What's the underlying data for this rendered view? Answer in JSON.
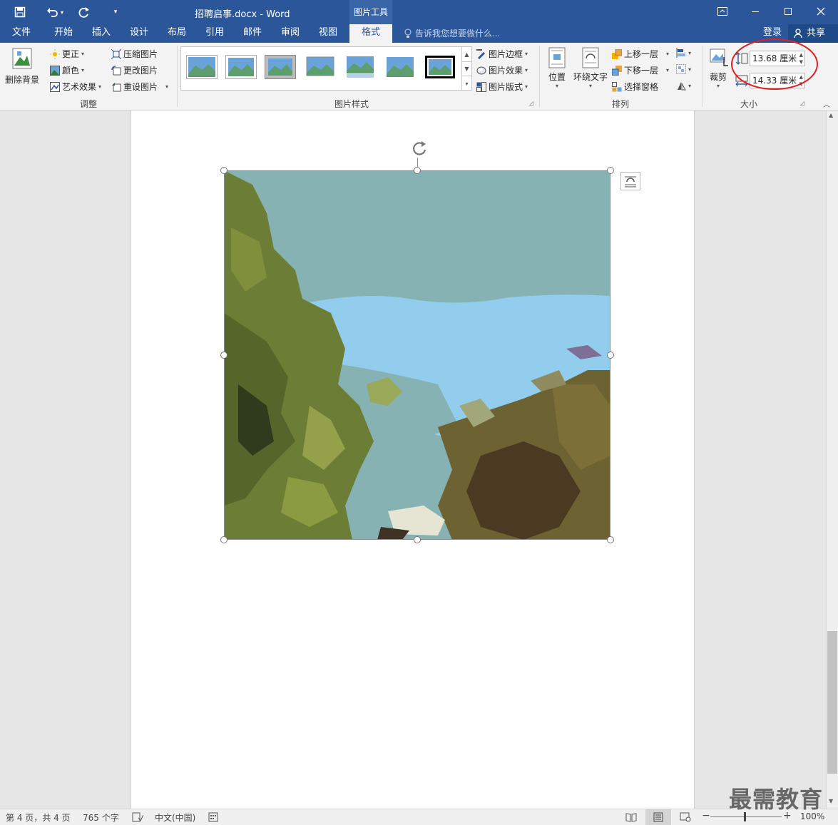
{
  "titlebar": {
    "document_title": "招聘启事.docx - Word",
    "contextual_tools": "图片工具",
    "icons": [
      "save-icon",
      "undo-icon",
      "redo-icon",
      "customize-icon",
      "ribbon-display-icon",
      "minimize-icon",
      "maximize-icon",
      "close-icon"
    ]
  },
  "tabs": {
    "items": [
      "文件",
      "开始",
      "插入",
      "设计",
      "布局",
      "引用",
      "邮件",
      "审阅",
      "视图",
      "格式"
    ],
    "active": "格式",
    "tell_me": "告诉我您想要做什么...",
    "sign_in": "登录",
    "share": "共享"
  },
  "ribbon": {
    "adjust": {
      "label": "调整",
      "remove_background": "删除背景",
      "corrections": "更正",
      "color": "颜色",
      "artistic_effects": "艺术效果",
      "compress": "压缩图片",
      "change_picture": "更改图片",
      "reset_picture": "重设图片"
    },
    "picture_styles": {
      "label": "图片样式",
      "border": "图片边框",
      "effects": "图片效果",
      "layout": "图片版式",
      "style_count": 7
    },
    "arrange": {
      "label": "排列",
      "position": "位置",
      "wrap_text": "环绕文字",
      "bring_forward": "上移一层",
      "send_backward": "下移一层",
      "selection_pane": "选择窗格"
    },
    "size": {
      "label": "大小",
      "crop": "裁剪",
      "height": "13.68 厘米",
      "width": "14.33 厘米"
    }
  },
  "statusbar": {
    "page": "第 4 页，共 4 页",
    "words": "765 个字",
    "language": "中文(中国)",
    "zoom": "100%"
  },
  "watermark": "最需教育",
  "colors": {
    "accent": "#2b579a",
    "highlight_circle": "#e02020"
  }
}
